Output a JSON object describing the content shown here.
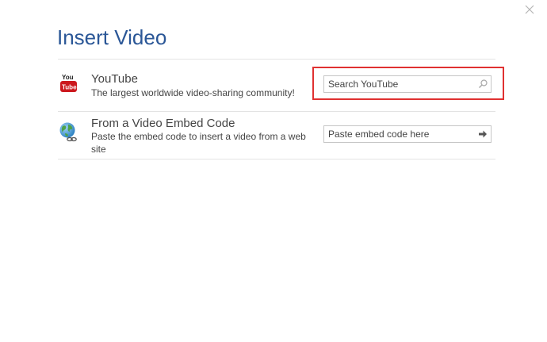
{
  "dialog": {
    "title": "Insert Video"
  },
  "sources": [
    {
      "title": "YouTube",
      "description": "The largest worldwide video-sharing community!",
      "icon": "youtube-icon",
      "icon_text_top": "You",
      "icon_text_bottom": "Tube",
      "placeholder": "Search YouTube",
      "button_icon": "search-icon"
    },
    {
      "title": "From a Video Embed Code",
      "description": "Paste the embed code to insert a video from a web site",
      "icon": "globe-link-icon",
      "placeholder": "Paste embed code here",
      "button_icon": "arrow-right-icon"
    }
  ],
  "colors": {
    "title": "#2b5797",
    "highlight": "#e03131",
    "youtube_red": "#cc181e"
  }
}
